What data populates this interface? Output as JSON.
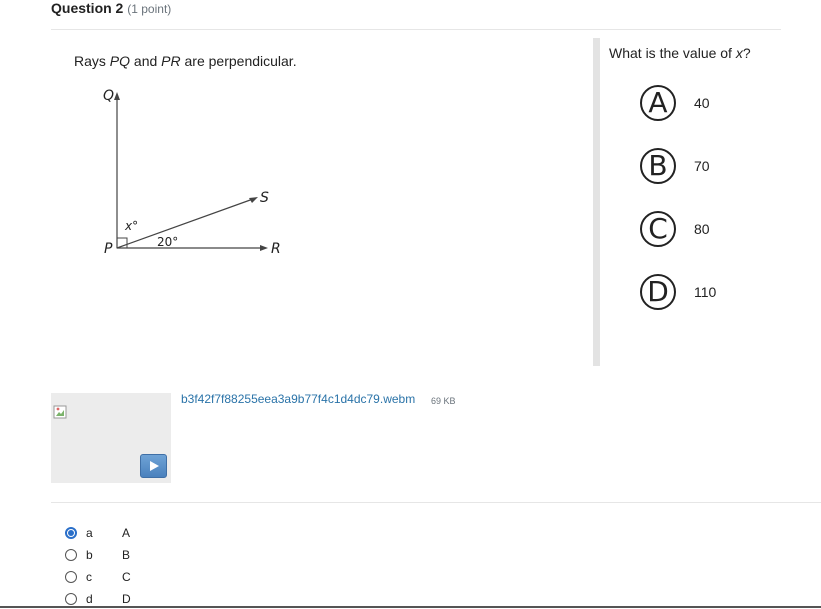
{
  "question": {
    "title": "Question 2",
    "points": "(1 point)"
  },
  "prompt": {
    "pre": "Rays ",
    "ray1": "PQ",
    "mid": " and ",
    "ray2": "PR",
    "post": " are perpendicular."
  },
  "diagram": {
    "labels": {
      "q": "Q",
      "s": "S",
      "p": "P",
      "r": "R",
      "x": "x°",
      "angle": "20°"
    }
  },
  "side": {
    "question_pre": "What is the value of ",
    "question_var": "x",
    "question_post": "?",
    "choices": [
      {
        "letter": "A",
        "value": "40"
      },
      {
        "letter": "B",
        "value": "70"
      },
      {
        "letter": "C",
        "value": "80"
      },
      {
        "letter": "D",
        "value": "110"
      }
    ]
  },
  "attachment": {
    "filename": "b3f42f7f88255eea3a9b77f4c1d4dc79.webm",
    "size": "69 KB",
    "play_icon": "play-icon"
  },
  "options": [
    {
      "letter": "a",
      "answer": "A",
      "checked": true
    },
    {
      "letter": "b",
      "answer": "B",
      "checked": false
    },
    {
      "letter": "c",
      "answer": "C",
      "checked": false
    },
    {
      "letter": "d",
      "answer": "D",
      "checked": false
    }
  ],
  "colors": {
    "accent": "#2a6fc9",
    "link": "#2a73a8"
  }
}
